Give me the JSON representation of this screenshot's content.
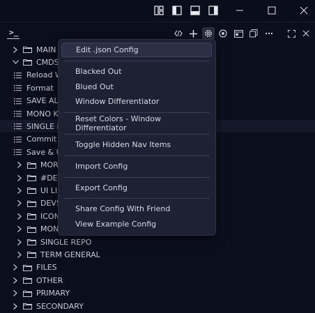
{
  "window": {
    "controls": [
      "toggle-layout-icon",
      "toggle-primary-sidebar-icon",
      "toggle-panel-icon",
      "toggle-secondary-sidebar-icon",
      "minimize-icon",
      "maximize-icon",
      "close-icon"
    ]
  },
  "panel": {
    "terminal_glyph": ">_",
    "toolbar_icons": [
      "code-icon",
      "plus-icon",
      "gear-icon",
      "palette-icon",
      "webview-icon",
      "copy-icon",
      "more-icon",
      "maximize-panel-icon",
      "close-panel-icon"
    ]
  },
  "tree": {
    "rows": [
      {
        "label": "MAIN",
        "kind": "folder",
        "expanded": false,
        "indent": 0
      },
      {
        "label": "CMDS",
        "kind": "folder",
        "expanded": true,
        "indent": 0
      },
      {
        "label": "Reload W",
        "kind": "item",
        "indent": 1
      },
      {
        "label": "Format",
        "kind": "item",
        "indent": 1
      },
      {
        "label": "SAVE ALL",
        "kind": "item",
        "indent": 1
      },
      {
        "label": "MONO K",
        "kind": "item",
        "indent": 1
      },
      {
        "label": "SINGLE K",
        "kind": "item",
        "indent": 1,
        "highlight": true
      },
      {
        "label": "Commit A",
        "kind": "item",
        "indent": 1
      },
      {
        "label": "Save & U",
        "kind": "item",
        "indent": 1
      },
      {
        "label": "MORE",
        "kind": "folder",
        "expanded": false,
        "indent": 1
      },
      {
        "label": "#DEV",
        "kind": "folder",
        "expanded": false,
        "indent": 1
      },
      {
        "label": "UI LIB",
        "kind": "folder",
        "expanded": false,
        "indent": 1
      },
      {
        "label": "DEVS",
        "kind": "folder",
        "expanded": false,
        "indent": 1
      },
      {
        "label": "ICON",
        "kind": "folder",
        "expanded": false,
        "indent": 1
      },
      {
        "label": "MON",
        "kind": "folder",
        "expanded": false,
        "indent": 1
      },
      {
        "label": "SINGLE REPO",
        "kind": "folder",
        "expanded": false,
        "indent": 1
      },
      {
        "label": "TERM GENERAL",
        "kind": "folder",
        "expanded": false,
        "indent": 1
      },
      {
        "label": "FILES",
        "kind": "folder",
        "expanded": false,
        "indent": 0
      },
      {
        "label": "OTHER",
        "kind": "folder",
        "expanded": false,
        "indent": 0
      },
      {
        "label": "PRIMARY",
        "kind": "folder",
        "expanded": false,
        "indent": 0
      },
      {
        "label": "SECONDARY",
        "kind": "folder",
        "expanded": false,
        "indent": 0
      }
    ]
  },
  "context_menu": {
    "groups": [
      [
        "Edit .json Config"
      ],
      [
        "Blacked Out",
        "Blued Out",
        "Window Differentiator"
      ],
      [
        "Reset Colors - Window Differentiator"
      ],
      [
        "Toggle Hidden Nav Items"
      ],
      [
        "Import Config"
      ],
      [
        "Export Config"
      ],
      [
        "Share Config With Friend",
        "View Example Config"
      ]
    ],
    "selected": "Edit .json Config"
  },
  "colors": {
    "background": "#0b0e1d",
    "menu_bg": "#1d2133",
    "menu_selected": "#2b3046",
    "text": "#c6c9d4"
  }
}
